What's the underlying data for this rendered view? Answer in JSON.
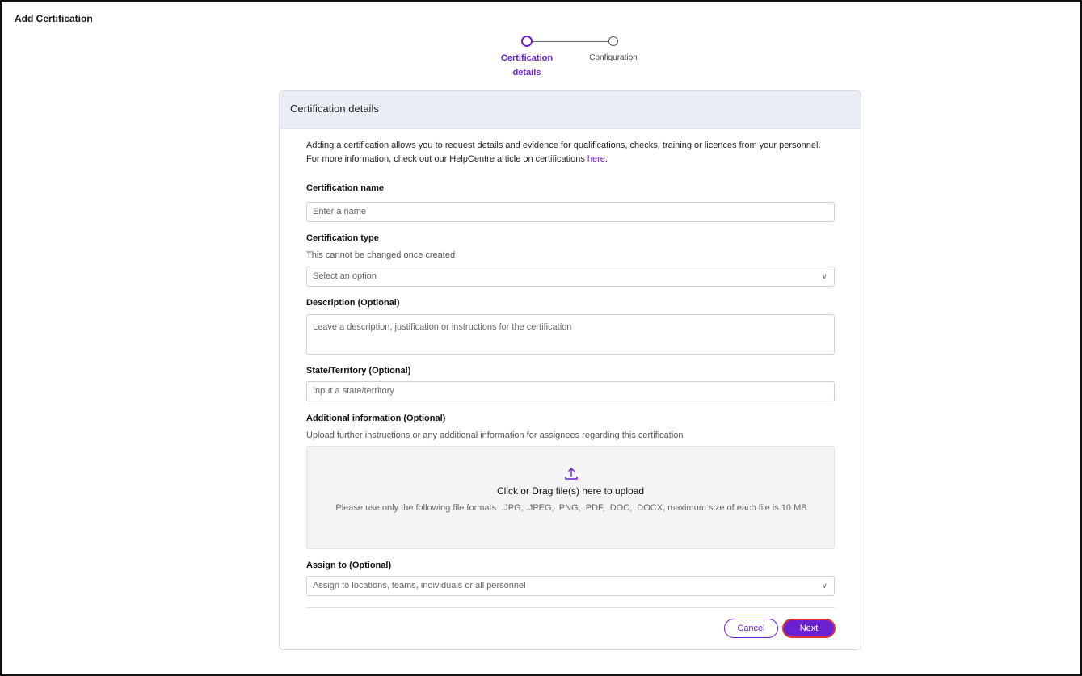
{
  "page": {
    "title": "Add Certification"
  },
  "stepper": {
    "steps": [
      {
        "label": "Certification details",
        "active": true
      },
      {
        "label": "Configuration",
        "active": false
      }
    ]
  },
  "card": {
    "header": "Certification details",
    "intro": "Adding a certification allows you to request details and evidence for qualifications, checks, training or licences from your personnel. For more information, check out our HelpCentre article on certifications ",
    "intro_link": "here",
    "intro_end": ".",
    "fields": {
      "name": {
        "label": "Certification name",
        "placeholder": "Enter a name"
      },
      "type": {
        "label": "Certification type",
        "hint": "This cannot be changed once created",
        "placeholder": "Select an option"
      },
      "description": {
        "label": "Description (Optional)",
        "placeholder": "Leave a description, justification or instructions for the certification"
      },
      "state": {
        "label": "State/Territory (Optional)",
        "placeholder": "Input a state/territory"
      },
      "additional": {
        "label": "Additional information (Optional)",
        "hint": "Upload further instructions or any additional information for assignees regarding this certification",
        "upload_title": "Click or Drag file(s) here to upload",
        "upload_hint": "Please use only the following file formats: .JPG, .JPEG, .PNG, .PDF, .DOC, .DOCX, maximum size of each file is 10 MB"
      },
      "assign": {
        "label": "Assign to (Optional)",
        "placeholder": "Assign to locations, teams, individuals or all personnel"
      }
    },
    "buttons": {
      "cancel": "Cancel",
      "next": "Next"
    }
  },
  "colors": {
    "accent": "#6b21d1",
    "header_bg": "#e9edf4",
    "upload_bg": "#f4f4f4"
  },
  "icons": {
    "select_chevron": "chevron-down-icon",
    "upload": "upload-icon"
  }
}
